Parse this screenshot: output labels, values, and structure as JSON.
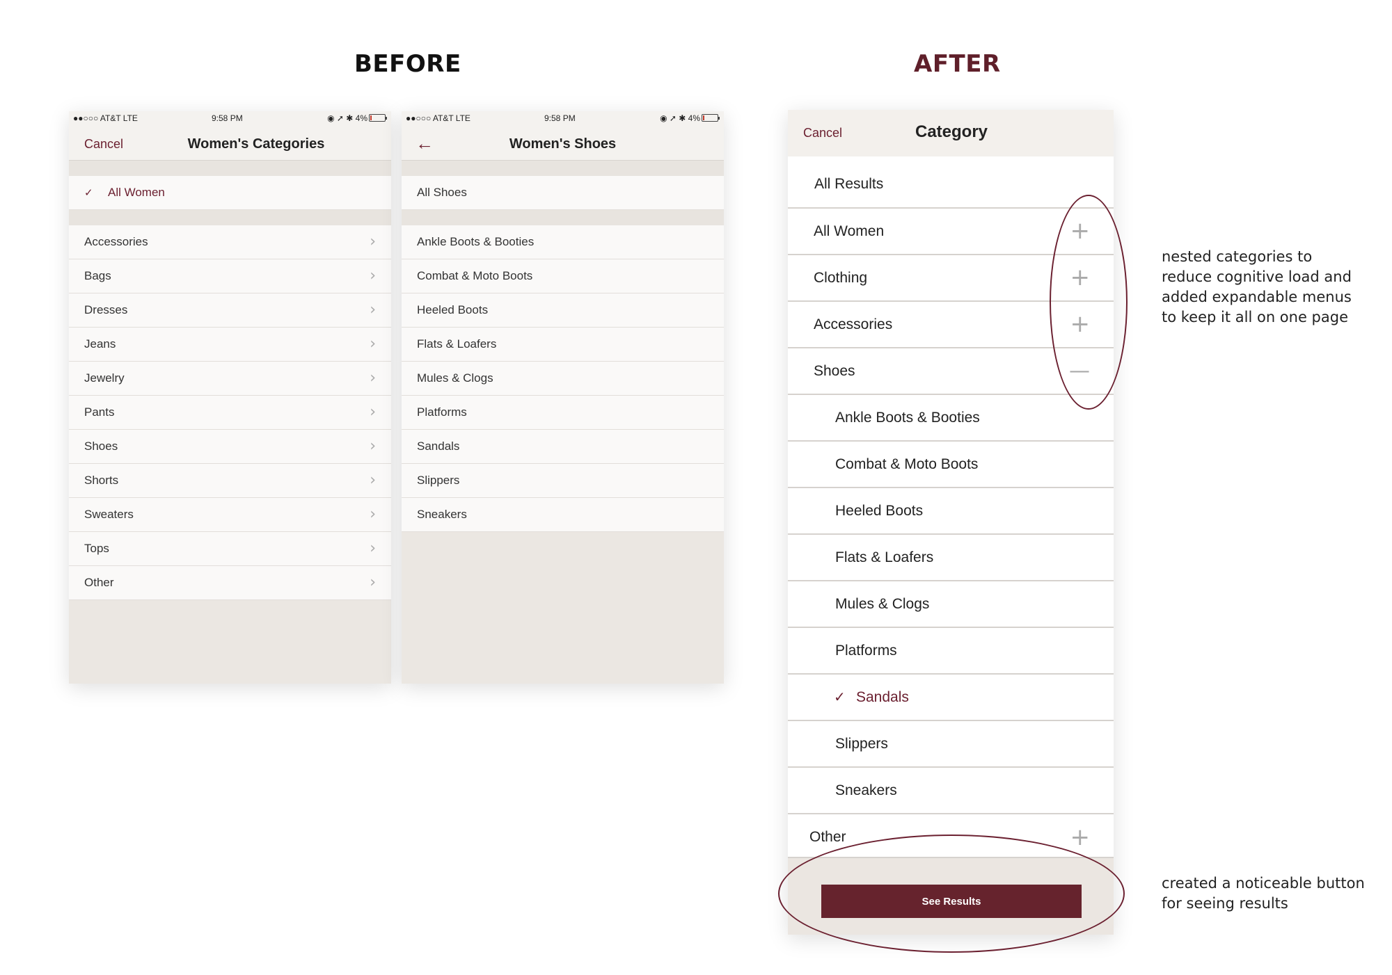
{
  "headings": {
    "before": "BEFORE",
    "after": "AFTER"
  },
  "screen1": {
    "status": {
      "carrier": "●●○○○ AT&T  LTE",
      "time": "9:58 PM",
      "right": "◉ ➚ ✱ 4%"
    },
    "cancel": "Cancel",
    "title": "Women's Categories",
    "selected": "All Women",
    "items": [
      "Accessories",
      "Bags",
      "Dresses",
      "Jeans",
      "Jewelry",
      "Pants",
      "Shoes",
      "Shorts",
      "Sweaters",
      "Tops",
      "Other"
    ]
  },
  "screen2": {
    "status": {
      "carrier": "●●○○○ AT&T  LTE",
      "time": "9:58 PM",
      "right": "◉ ➚ ✱ 4%"
    },
    "title": "Women's Shoes",
    "all": "All Shoes",
    "items": [
      "Ankle Boots & Booties",
      "Combat & Moto Boots",
      "Heeled Boots",
      "Flats & Loafers",
      "Mules & Clogs",
      "Platforms",
      "Sandals",
      "Slippers",
      "Sneakers"
    ]
  },
  "screen3": {
    "cancel": "Cancel",
    "title": "Category",
    "all_results": "All Results",
    "parents": [
      "All Women",
      "Clothing",
      "Accessories",
      "Shoes"
    ],
    "children": [
      "Ankle Boots & Booties",
      "Combat & Moto Boots",
      "Heeled Boots",
      "Flats & Loafers",
      "Mules & Clogs",
      "Platforms",
      "Sandals",
      "Slippers",
      "Sneakers"
    ],
    "selected_child": "Sandals",
    "other": "Other",
    "button": "See Results"
  },
  "notes": {
    "nested": "nested categories to reduce cognitive load and added expandable menus to keep it all on one page",
    "button": "created a noticeable button for seeing results"
  },
  "colors": {
    "accent": "#6b2030",
    "button": "#66232d",
    "after_heading": "#5f1f2a"
  },
  "icons": {
    "check": "check-icon",
    "chevron": "chevron-right-icon",
    "plus": "plus-icon",
    "minus": "minus-icon",
    "back": "back-arrow-icon"
  }
}
